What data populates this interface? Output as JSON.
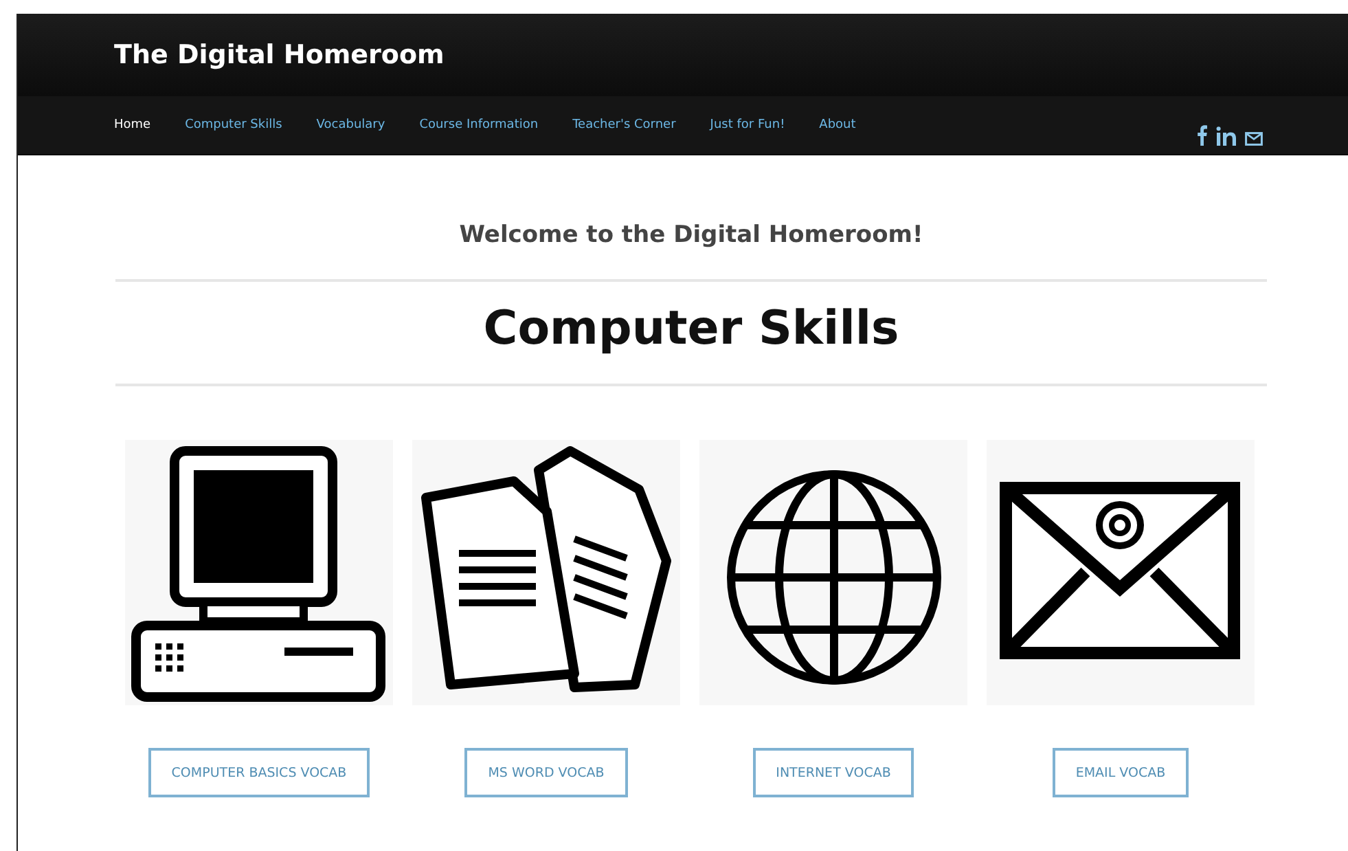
{
  "site": {
    "title": "The Digital Homeroom"
  },
  "nav": [
    {
      "label": "Home",
      "selected": true
    },
    {
      "label": "Computer Skills",
      "selected": false
    },
    {
      "label": "Vocabulary",
      "selected": false
    },
    {
      "label": "Course Information",
      "selected": false
    },
    {
      "label": "Teacher's Corner",
      "selected": false
    },
    {
      "label": "Just for Fun!",
      "selected": false
    },
    {
      "label": "About",
      "selected": false
    }
  ],
  "social": [
    {
      "kind": "facebook"
    },
    {
      "kind": "linkedin"
    },
    {
      "kind": "email"
    }
  ],
  "welcome": "Welcome to the Digital Homeroom!",
  "heading": "Computer Skills",
  "cards": [
    {
      "kind": "computer",
      "button": "COMPUTER BASICS VOCAB"
    },
    {
      "kind": "documents",
      "button": "MS WORD VOCAB"
    },
    {
      "kind": "globe",
      "button": "INTERNET VOCAB"
    },
    {
      "kind": "envelope",
      "button": "EMAIL VOCAB"
    }
  ]
}
